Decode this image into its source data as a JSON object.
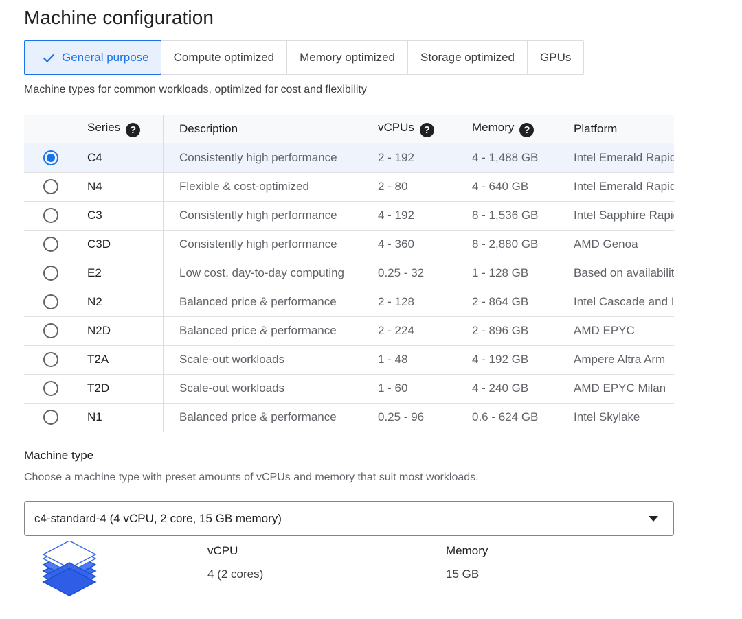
{
  "title": "Machine configuration",
  "tabs": [
    {
      "label": "General purpose",
      "active": true
    },
    {
      "label": "Compute optimized"
    },
    {
      "label": "Memory optimized"
    },
    {
      "label": "Storage optimized"
    },
    {
      "label": "GPUs"
    }
  ],
  "subtitle": "Machine types for common workloads, optimized for cost and flexibility",
  "table": {
    "headers": {
      "series": "Series",
      "description": "Description",
      "vcpus": "vCPUs",
      "memory": "Memory",
      "platform": "Platform"
    },
    "help_icon_glyph": "?",
    "rows": [
      {
        "series": "C4",
        "description": "Consistently high performance",
        "vcpus": "2 - 192",
        "memory": "4 - 1,488 GB",
        "platform": "Intel Emerald Rapids",
        "selected": true
      },
      {
        "series": "N4",
        "description": "Flexible & cost-optimized",
        "vcpus": "2 - 80",
        "memory": "4 - 640 GB",
        "platform": "Intel Emerald Rapids"
      },
      {
        "series": "C3",
        "description": "Consistently high performance",
        "vcpus": "4 - 192",
        "memory": "8 - 1,536 GB",
        "platform": "Intel Sapphire Rapids"
      },
      {
        "series": "C3D",
        "description": "Consistently high performance",
        "vcpus": "4 - 360",
        "memory": "8 - 2,880 GB",
        "platform": "AMD Genoa"
      },
      {
        "series": "E2",
        "description": "Low cost, day-to-day computing",
        "vcpus": "0.25 - 32",
        "memory": "1 - 128 GB",
        "platform": "Based on availability"
      },
      {
        "series": "N2",
        "description": "Balanced price & performance",
        "vcpus": "2 - 128",
        "memory": "2 - 864 GB",
        "platform": "Intel Cascade and Ice Lake"
      },
      {
        "series": "N2D",
        "description": "Balanced price & performance",
        "vcpus": "2 - 224",
        "memory": "2 - 896 GB",
        "platform": "AMD EPYC"
      },
      {
        "series": "T2A",
        "description": "Scale-out workloads",
        "vcpus": "1 - 48",
        "memory": "4 - 192 GB",
        "platform": "Ampere Altra Arm"
      },
      {
        "series": "T2D",
        "description": "Scale-out workloads",
        "vcpus": "1 - 60",
        "memory": "4 - 240 GB",
        "platform": "AMD EPYC Milan"
      },
      {
        "series": "N1",
        "description": "Balanced price & performance",
        "vcpus": "0.25 - 96",
        "memory": "0.6 - 624 GB",
        "platform": "Intel Skylake"
      }
    ]
  },
  "machine_type": {
    "title": "Machine type",
    "description": "Choose a machine type with preset amounts of vCPUs and memory that suit most workloads.",
    "selected": "c4-standard-4 (4 vCPU, 2 core, 15 GB memory)",
    "specs": {
      "vcpu_label": "vCPU",
      "vcpu_value": "4 (2 cores)",
      "memory_label": "Memory",
      "memory_value": "15 GB"
    }
  },
  "colors": {
    "accent": "#1a73e8",
    "selected_row": "#eef3fc",
    "header_bg": "#f8f9fa"
  },
  "icons": {
    "tab_active": "check-icon",
    "help": "help-icon",
    "dropdown": "dropdown-arrow-icon",
    "machine": "stacked-layers-icon"
  }
}
